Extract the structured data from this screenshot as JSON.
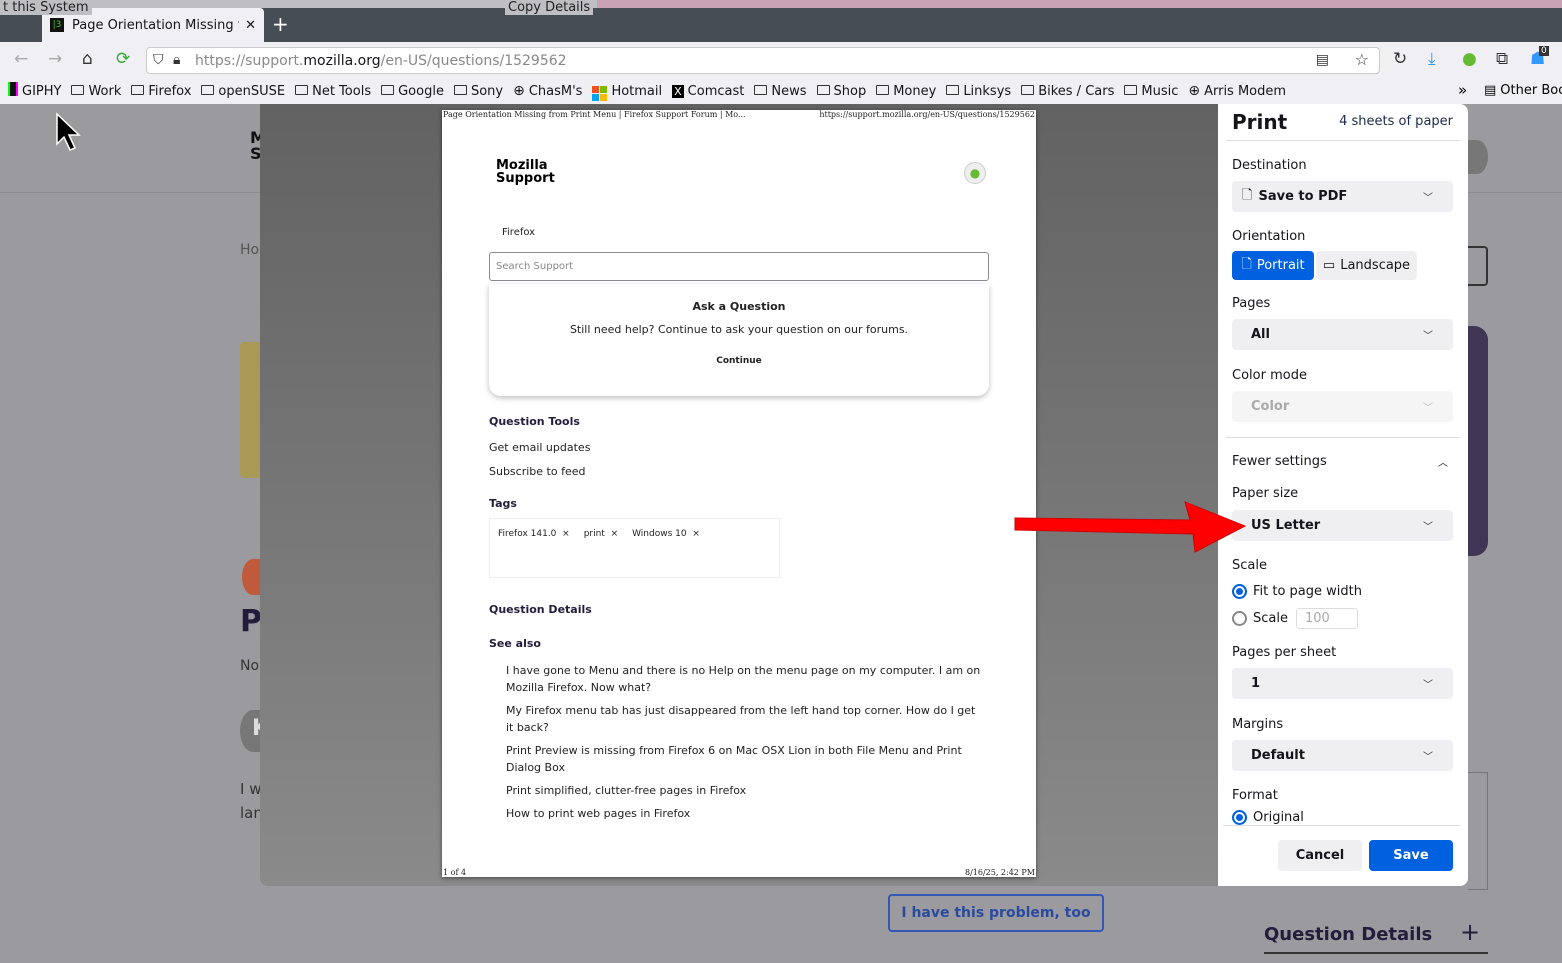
{
  "browser": {
    "background_tab_fragment": "t this System",
    "background_tab_fragment2": "Copy Details",
    "tab_title": "Page Orientation Missing from Print Menu | Firefox Support Forum",
    "new_tab": "+",
    "url_prefix": "https://support.",
    "url_domain": "mozilla.org",
    "url_path": "/en-US/questions/1529562",
    "extension_badge": "0",
    "bookmarks": [
      {
        "label": "GIPHY",
        "icon": "giphy-icon"
      },
      {
        "label": "Work",
        "icon": "folder-icon"
      },
      {
        "label": "Firefox",
        "icon": "folder-icon"
      },
      {
        "label": "openSUSE",
        "icon": "folder-icon"
      },
      {
        "label": "Net Tools",
        "icon": "folder-icon"
      },
      {
        "label": "Google",
        "icon": "folder-icon"
      },
      {
        "label": "Sony",
        "icon": "folder-icon"
      },
      {
        "label": "ChasM's",
        "icon": "globe-icon"
      },
      {
        "label": "Hotmail",
        "icon": "windows-icon"
      },
      {
        "label": "Comcast",
        "icon": "x-icon"
      },
      {
        "label": "News",
        "icon": "folder-icon"
      },
      {
        "label": "Shop",
        "icon": "folder-icon"
      },
      {
        "label": "Money",
        "icon": "folder-icon"
      },
      {
        "label": "Linksys",
        "icon": "folder-icon"
      },
      {
        "label": "Bikes / Cars",
        "icon": "folder-icon"
      },
      {
        "label": "Music",
        "icon": "folder-icon"
      },
      {
        "label": "Arris Modem",
        "icon": "globe-icon"
      }
    ],
    "other_bookmarks": "Other Bookmarks"
  },
  "background_page": {
    "breadcrumb_fragment": "Ho",
    "title_fragment": "P",
    "sub_fragment": "No",
    "avatar_letter": "K",
    "body_fragment1": "I w",
    "body_fragment2": "lan",
    "logo_fragment": "M S",
    "problem_button": "I have this problem, too",
    "question_details": "Question Details",
    "expand": "+"
  },
  "preview": {
    "header_left": "Page Orientation Missing from Print Menu | Firefox Support Forum | Mo...",
    "header_right": "https://support.mozilla.org/en-US/questions/1529562",
    "logo_line1": "Mozilla",
    "logo_line2": "Support",
    "product": "Firefox",
    "search_placeholder": "Search Support",
    "ask_title": "Ask a Question",
    "ask_text": "Still need help? Continue to ask your question on our forums.",
    "continue": "Continue",
    "tools_title": "Question Tools",
    "tools": [
      "Get email updates",
      "Subscribe to feed"
    ],
    "tags_title": "Tags",
    "tags": [
      "Firefox 141.0",
      "print",
      "Windows 10"
    ],
    "details_title": "Question Details",
    "see_also_title": "See also",
    "see_also": [
      "I have gone to Menu and there is no Help on the menu page on my computer. I am on Mozilla Firefox. Now what?",
      "My Firefox menu tab has just disappeared from the left hand top corner. How do I get it back?",
      "Print Preview is missing from Firefox 6 on Mac OSX Lion in both File Menu and Print Dialog Box",
      "Print simplified, clutter-free pages in Firefox",
      "How to print web pages in Firefox"
    ],
    "footer_left": "1 of 4",
    "footer_right": "8/16/25, 2:42 PM"
  },
  "print": {
    "title": "Print",
    "sheets": "4 sheets of paper",
    "destination_label": "Destination",
    "destination": "Save to PDF",
    "orientation_label": "Orientation",
    "portrait": "Portrait",
    "landscape": "Landscape",
    "orientation_selected": "Portrait",
    "pages_label": "Pages",
    "pages": "All",
    "color_label": "Color mode",
    "color": "Color",
    "fewer": "Fewer settings",
    "paper_label": "Paper size",
    "paper": "US Letter",
    "scale_label": "Scale",
    "fit": "Fit to page width",
    "scale_opt": "Scale",
    "scale_value": "100",
    "scale_selected": "Fit to page width",
    "pps_label": "Pages per sheet",
    "pps": "1",
    "margins_label": "Margins",
    "margins": "Default",
    "format_label": "Format",
    "format": "Original",
    "cancel": "Cancel",
    "save": "Save",
    "accent": "#0061e0"
  },
  "annotation": {
    "arrow_color": "#ff0000"
  }
}
